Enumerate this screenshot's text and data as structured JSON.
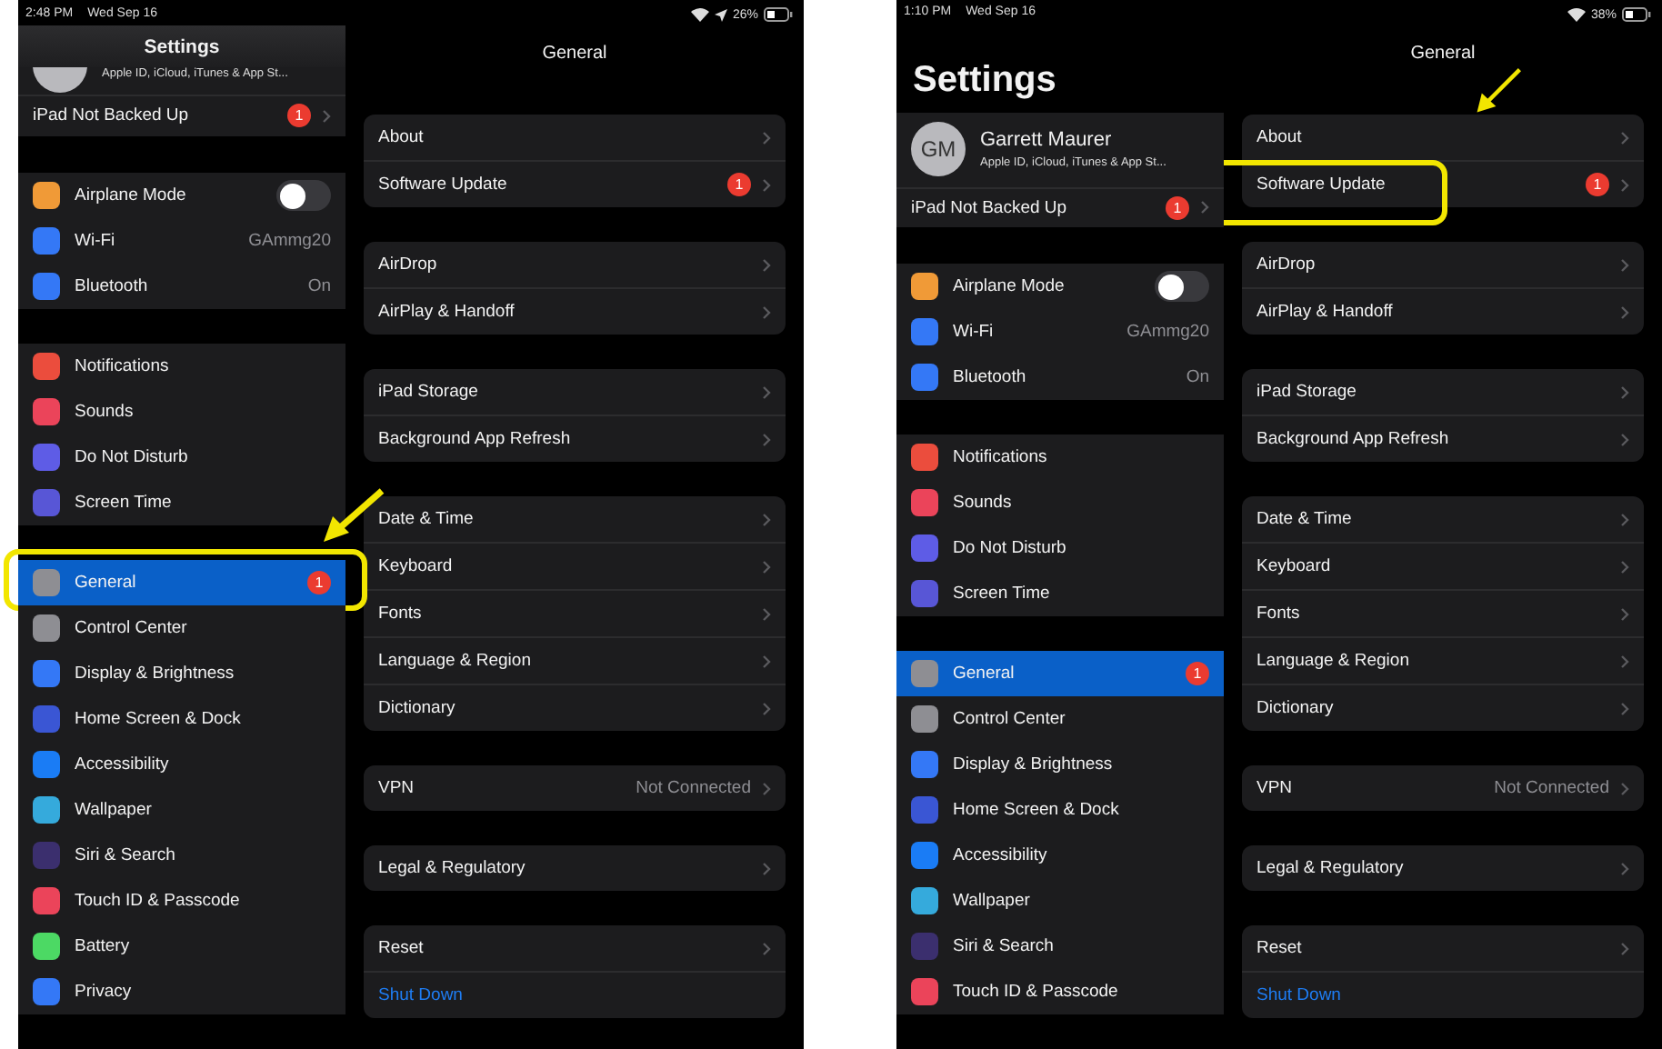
{
  "screens": [
    {
      "status_bar": {
        "time": "2:48 PM",
        "date": "Wed Sep 16",
        "location": true,
        "battery": "26%"
      },
      "sidebar": {
        "title": "Settings",
        "large_title": false,
        "profile": {
          "subtitle": "Apple ID, iCloud, iTunes & App St..."
        },
        "backup": {
          "label": "iPad Not Backed Up",
          "badge": "1"
        },
        "groups": [
          [
            {
              "label": "Airplane Mode",
              "kind": "toggle",
              "on": false,
              "color": "#f09a37",
              "selected": false,
              "highlighted": false
            },
            {
              "label": "Wi-Fi",
              "kind": "value",
              "value": "GAmmg20",
              "color": "#3478f6",
              "selected": false,
              "highlighted": false
            },
            {
              "label": "Bluetooth",
              "kind": "value",
              "value": "On",
              "color": "#3478f6",
              "selected": false,
              "highlighted": false
            }
          ],
          [
            {
              "label": "Notifications",
              "kind": "plain",
              "color": "#eb4d3d",
              "selected": false,
              "highlighted": false
            },
            {
              "label": "Sounds",
              "kind": "plain",
              "color": "#eb445a",
              "selected": false,
              "highlighted": false
            },
            {
              "label": "Do Not Disturb",
              "kind": "plain",
              "color": "#5e5ce6",
              "selected": false,
              "highlighted": false
            },
            {
              "label": "Screen Time",
              "kind": "plain",
              "color": "#5856d6",
              "selected": false,
              "highlighted": false
            }
          ],
          [
            {
              "label": "General",
              "kind": "badge",
              "badge": "1",
              "color": "#8e8e93",
              "selected": true,
              "highlighted": true
            },
            {
              "label": "Control Center",
              "kind": "plain",
              "color": "#8e8e93",
              "selected": false,
              "highlighted": false
            },
            {
              "label": "Display & Brightness",
              "kind": "plain",
              "color": "#3478f6",
              "selected": false,
              "highlighted": false
            },
            {
              "label": "Home Screen & Dock",
              "kind": "plain",
              "color": "#3a56d4",
              "selected": false,
              "highlighted": false
            },
            {
              "label": "Accessibility",
              "kind": "plain",
              "color": "#1a7cf5",
              "selected": false,
              "highlighted": false
            },
            {
              "label": "Wallpaper",
              "kind": "plain",
              "color": "#35aadc",
              "selected": false,
              "highlighted": false
            },
            {
              "label": "Siri & Search",
              "kind": "plain",
              "color": "#3b2f6e",
              "selected": false,
              "highlighted": false
            },
            {
              "label": "Touch ID & Passcode",
              "kind": "plain",
              "color": "#eb445a",
              "selected": false,
              "highlighted": false
            },
            {
              "label": "Battery",
              "kind": "plain",
              "color": "#4cd964",
              "selected": false,
              "highlighted": false
            },
            {
              "label": "Privacy",
              "kind": "plain",
              "color": "#3478f6",
              "selected": false,
              "highlighted": false
            }
          ]
        ]
      },
      "detail": {
        "title": "General",
        "groups": [
          [
            {
              "label": "About",
              "kind": "link",
              "highlighted": false
            },
            {
              "label": "Software Update",
              "kind": "link",
              "badge": "1",
              "highlighted": false
            }
          ],
          [
            {
              "label": "AirDrop",
              "kind": "link",
              "highlighted": false
            },
            {
              "label": "AirPlay & Handoff",
              "kind": "link",
              "highlighted": false
            }
          ],
          [
            {
              "label": "iPad Storage",
              "kind": "link",
              "highlighted": false
            },
            {
              "label": "Background App Refresh",
              "kind": "link",
              "highlighted": false
            }
          ],
          [
            {
              "label": "Date & Time",
              "kind": "link",
              "highlighted": false
            },
            {
              "label": "Keyboard",
              "kind": "link",
              "highlighted": false
            },
            {
              "label": "Fonts",
              "kind": "link",
              "highlighted": false
            },
            {
              "label": "Language & Region",
              "kind": "link",
              "highlighted": false
            },
            {
              "label": "Dictionary",
              "kind": "link",
              "highlighted": false
            }
          ],
          [
            {
              "label": "VPN",
              "kind": "link",
              "value": "Not Connected",
              "highlighted": false
            }
          ],
          [
            {
              "label": "Legal & Regulatory",
              "kind": "link",
              "highlighted": false
            }
          ],
          [
            {
              "label": "Reset",
              "kind": "link",
              "highlighted": false
            },
            {
              "label": "Shut Down",
              "kind": "action",
              "highlighted": false
            }
          ]
        ]
      }
    },
    {
      "status_bar": {
        "time": "1:10 PM",
        "date": "Wed Sep 16",
        "location": false,
        "battery": "38%"
      },
      "sidebar": {
        "title": "Settings",
        "large_title": true,
        "profile": {
          "initials": "GM",
          "name": "Garrett Maurer",
          "subtitle": "Apple ID, iCloud, iTunes & App St..."
        },
        "backup": {
          "label": "iPad Not Backed Up",
          "badge": "1"
        },
        "groups": [
          [
            {
              "label": "Airplane Mode",
              "kind": "toggle",
              "on": false,
              "color": "#f09a37",
              "selected": false,
              "highlighted": false
            },
            {
              "label": "Wi-Fi",
              "kind": "value",
              "value": "GAmmg20",
              "color": "#3478f6",
              "selected": false,
              "highlighted": false
            },
            {
              "label": "Bluetooth",
              "kind": "value",
              "value": "On",
              "color": "#3478f6",
              "selected": false,
              "highlighted": false
            }
          ],
          [
            {
              "label": "Notifications",
              "kind": "plain",
              "color": "#eb4d3d",
              "selected": false,
              "highlighted": false
            },
            {
              "label": "Sounds",
              "kind": "plain",
              "color": "#eb445a",
              "selected": false,
              "highlighted": false
            },
            {
              "label": "Do Not Disturb",
              "kind": "plain",
              "color": "#5e5ce6",
              "selected": false,
              "highlighted": false
            },
            {
              "label": "Screen Time",
              "kind": "plain",
              "color": "#5856d6",
              "selected": false,
              "highlighted": false
            }
          ],
          [
            {
              "label": "General",
              "kind": "badge",
              "badge": "1",
              "color": "#8e8e93",
              "selected": true,
              "highlighted": false
            },
            {
              "label": "Control Center",
              "kind": "plain",
              "color": "#8e8e93",
              "selected": false,
              "highlighted": false
            },
            {
              "label": "Display & Brightness",
              "kind": "plain",
              "color": "#3478f6",
              "selected": false,
              "highlighted": false
            },
            {
              "label": "Home Screen & Dock",
              "kind": "plain",
              "color": "#3a56d4",
              "selected": false,
              "highlighted": false
            },
            {
              "label": "Accessibility",
              "kind": "plain",
              "color": "#1a7cf5",
              "selected": false,
              "highlighted": false
            },
            {
              "label": "Wallpaper",
              "kind": "plain",
              "color": "#35aadc",
              "selected": false,
              "highlighted": false
            },
            {
              "label": "Siri & Search",
              "kind": "plain",
              "color": "#3b2f6e",
              "selected": false,
              "highlighted": false
            },
            {
              "label": "Touch ID & Passcode",
              "kind": "plain",
              "color": "#eb445a",
              "selected": false,
              "highlighted": false
            }
          ]
        ]
      },
      "detail": {
        "title": "General",
        "groups": [
          [
            {
              "label": "About",
              "kind": "link",
              "highlighted": false
            },
            {
              "label": "Software Update",
              "kind": "link",
              "badge": "1",
              "highlighted": true
            }
          ],
          [
            {
              "label": "AirDrop",
              "kind": "link",
              "highlighted": false
            },
            {
              "label": "AirPlay & Handoff",
              "kind": "link",
              "highlighted": false
            }
          ],
          [
            {
              "label": "iPad Storage",
              "kind": "link",
              "highlighted": false
            },
            {
              "label": "Background App Refresh",
              "kind": "link",
              "highlighted": false
            }
          ],
          [
            {
              "label": "Date & Time",
              "kind": "link",
              "highlighted": false
            },
            {
              "label": "Keyboard",
              "kind": "link",
              "highlighted": false
            },
            {
              "label": "Fonts",
              "kind": "link",
              "highlighted": false
            },
            {
              "label": "Language & Region",
              "kind": "link",
              "highlighted": false
            },
            {
              "label": "Dictionary",
              "kind": "link",
              "highlighted": false
            }
          ],
          [
            {
              "label": "VPN",
              "kind": "link",
              "value": "Not Connected",
              "highlighted": false
            }
          ],
          [
            {
              "label": "Legal & Regulatory",
              "kind": "link",
              "highlighted": false
            }
          ],
          [
            {
              "label": "Reset",
              "kind": "link",
              "highlighted": false
            },
            {
              "label": "Shut Down",
              "kind": "action",
              "highlighted": false
            }
          ]
        ]
      }
    }
  ]
}
